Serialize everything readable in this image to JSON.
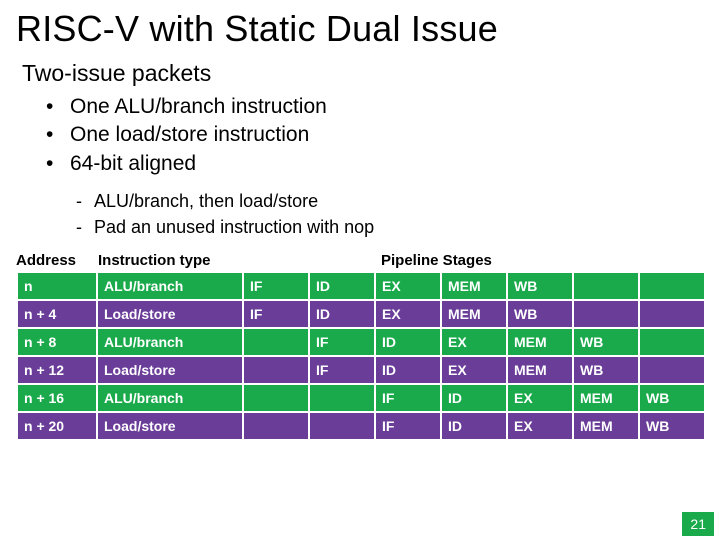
{
  "title": "RISC-V with Static Dual Issue",
  "subheading": "Two-issue packets",
  "bullets_l1": [
    "One ALU/branch instruction",
    "One load/store instruction",
    "64-bit aligned"
  ],
  "bullets_l2": [
    "ALU/branch, then load/store",
    "Pad an unused instruction with nop"
  ],
  "headers": {
    "address": "Address",
    "itype": "Instruction type",
    "stages": "Pipeline Stages"
  },
  "rows": [
    {
      "addr": "n",
      "itype": "ALU/branch",
      "color": "green",
      "stages": [
        "IF",
        "ID",
        "EX",
        "MEM",
        "WB",
        "",
        ""
      ]
    },
    {
      "addr": "n + 4",
      "itype": "Load/store",
      "color": "purple",
      "stages": [
        "IF",
        "ID",
        "EX",
        "MEM",
        "WB",
        "",
        ""
      ]
    },
    {
      "addr": "n + 8",
      "itype": "ALU/branch",
      "color": "green",
      "stages": [
        "",
        "IF",
        "ID",
        "EX",
        "MEM",
        "WB",
        ""
      ]
    },
    {
      "addr": "n + 12",
      "itype": "Load/store",
      "color": "purple",
      "stages": [
        "",
        "IF",
        "ID",
        "EX",
        "MEM",
        "WB",
        ""
      ]
    },
    {
      "addr": "n + 16",
      "itype": "ALU/branch",
      "color": "green",
      "stages": [
        "",
        "",
        "IF",
        "ID",
        "EX",
        "MEM",
        "WB"
      ]
    },
    {
      "addr": "n + 20",
      "itype": "Load/store",
      "color": "purple",
      "stages": [
        "",
        "",
        "IF",
        "ID",
        "EX",
        "MEM",
        "WB"
      ]
    }
  ],
  "page_number": "21"
}
